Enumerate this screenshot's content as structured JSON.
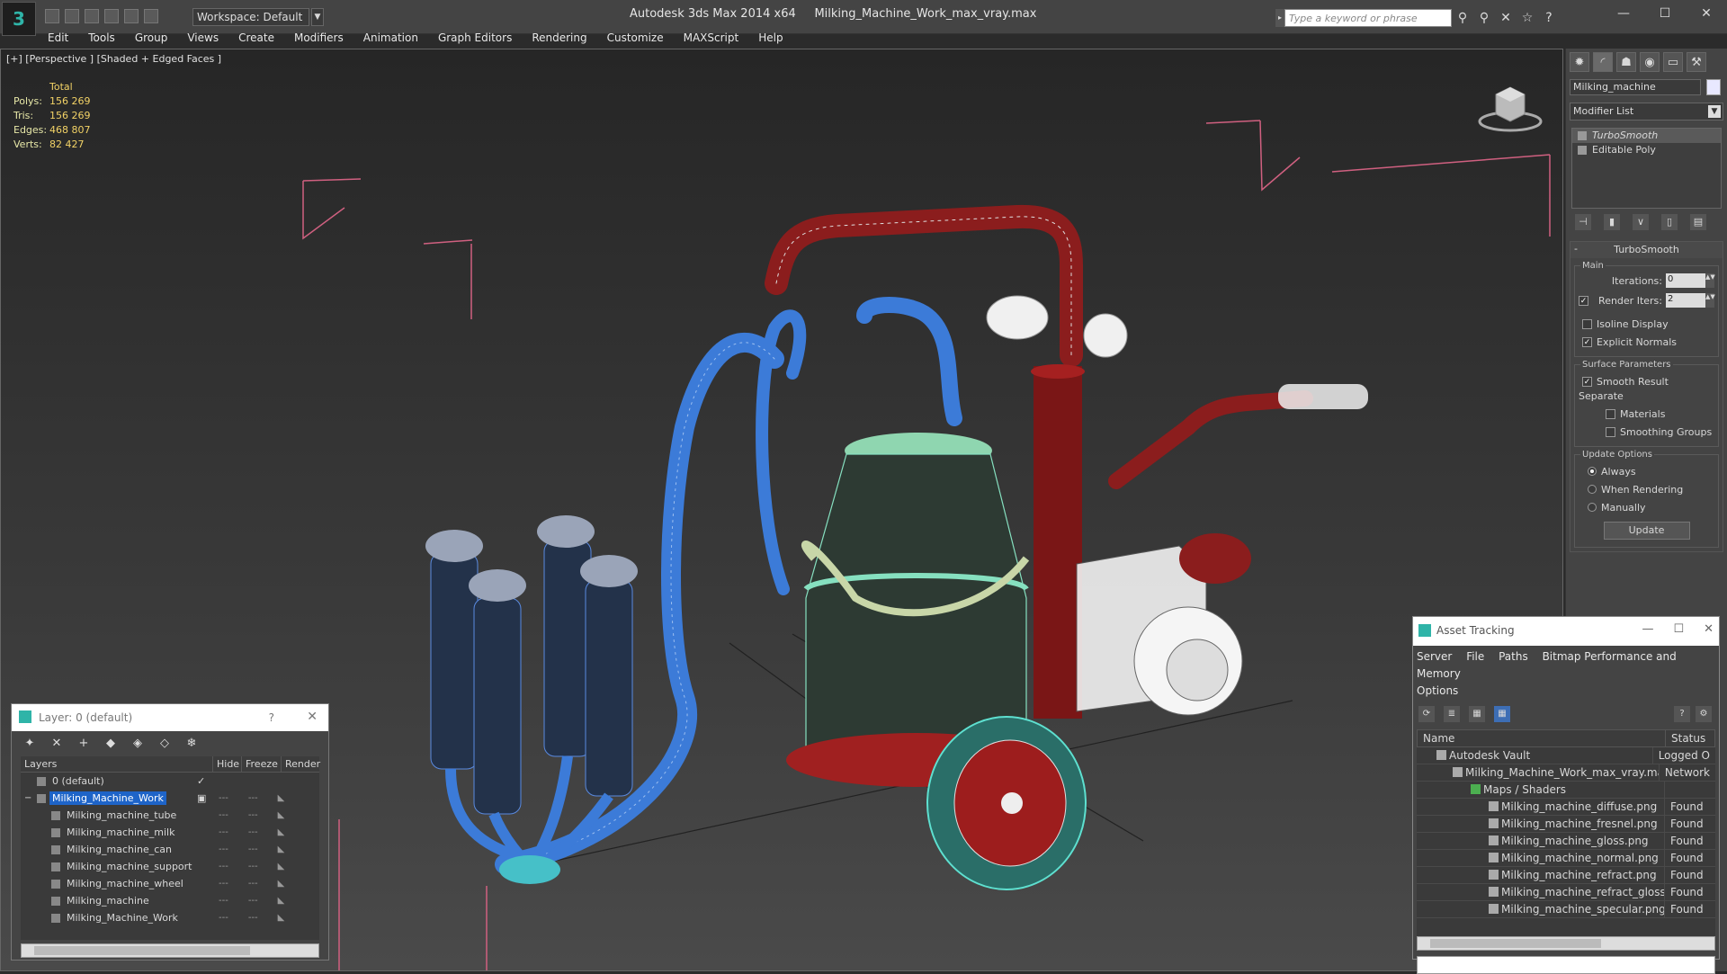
{
  "app": {
    "title": "Autodesk 3ds Max  2014 x64",
    "file": "Milking_Machine_Work_max_vray.max",
    "workspace": "Workspace: Default",
    "search_placeholder": "Type a keyword or phrase"
  },
  "menu": [
    "Edit",
    "Tools",
    "Group",
    "Views",
    "Create",
    "Modifiers",
    "Animation",
    "Graph Editors",
    "Rendering",
    "Customize",
    "MAXScript",
    "Help"
  ],
  "viewport": {
    "label": "[+] [Perspective ] [Shaded + Edged Faces ]",
    "stats": {
      "header": "Total",
      "polys_label": "Polys:",
      "polys": "156 269",
      "tris_label": "Tris:",
      "tris": "156 269",
      "edges_label": "Edges:",
      "edges": "468 807",
      "verts_label": "Verts:",
      "verts": "82 427"
    }
  },
  "command_panel": {
    "object_name": "Milking_machine",
    "modifier_list": "Modifier List",
    "stack": [
      "TurboSmooth",
      "Editable Poly"
    ],
    "turbosmooth": {
      "title": "TurboSmooth",
      "main_group": "Main",
      "iterations_label": "Iterations:",
      "iterations": "0",
      "render_iters_label": "Render Iters:",
      "render_iters": "2",
      "isoline": "Isoline Display",
      "explicit_normals": "Explicit Normals",
      "surface_group": "Surface Parameters",
      "smooth_result": "Smooth Result",
      "separate": "Separate",
      "materials": "Materials",
      "smoothing_groups": "Smoothing Groups",
      "update_group": "Update Options",
      "always": "Always",
      "when_rendering": "When Rendering",
      "manually": "Manually",
      "update": "Update"
    }
  },
  "layer_window": {
    "title": "Layer: 0 (default)",
    "help": "?",
    "columns": [
      "Layers",
      "Hide",
      "Freeze",
      "Render"
    ],
    "rows": [
      {
        "name": "0 (default)"
      },
      {
        "name": "Milking_Machine_Work"
      },
      {
        "name": "Milking_machine_tube"
      },
      {
        "name": "Milking_machine_milk"
      },
      {
        "name": "Milking_machine_can"
      },
      {
        "name": "Milking_machine_support"
      },
      {
        "name": "Milking_machine_wheel"
      },
      {
        "name": "Milking_machine"
      },
      {
        "name": "Milking_Machine_Work"
      }
    ]
  },
  "asset_window": {
    "title": "Asset Tracking",
    "menu": [
      "Server",
      "File",
      "Paths",
      "Bitmap Performance and Memory",
      "Options"
    ],
    "columns": [
      "Name",
      "Status"
    ],
    "rows": [
      {
        "name": "Autodesk Vault",
        "status": "Logged O"
      },
      {
        "name": "Milking_Machine_Work_max_vray.max",
        "status": "Network"
      },
      {
        "name": "Maps / Shaders",
        "status": ""
      },
      {
        "name": "Milking_machine_diffuse.png",
        "status": "Found"
      },
      {
        "name": "Milking_machine_fresnel.png",
        "status": "Found"
      },
      {
        "name": "Milking_machine_gloss.png",
        "status": "Found"
      },
      {
        "name": "Milking_machine_normal.png",
        "status": "Found"
      },
      {
        "name": "Milking_machine_refract.png",
        "status": "Found"
      },
      {
        "name": "Milking_machine_refract_gloss.png",
        "status": "Found"
      },
      {
        "name": "Milking_machine_specular.png",
        "status": "Found"
      }
    ]
  }
}
